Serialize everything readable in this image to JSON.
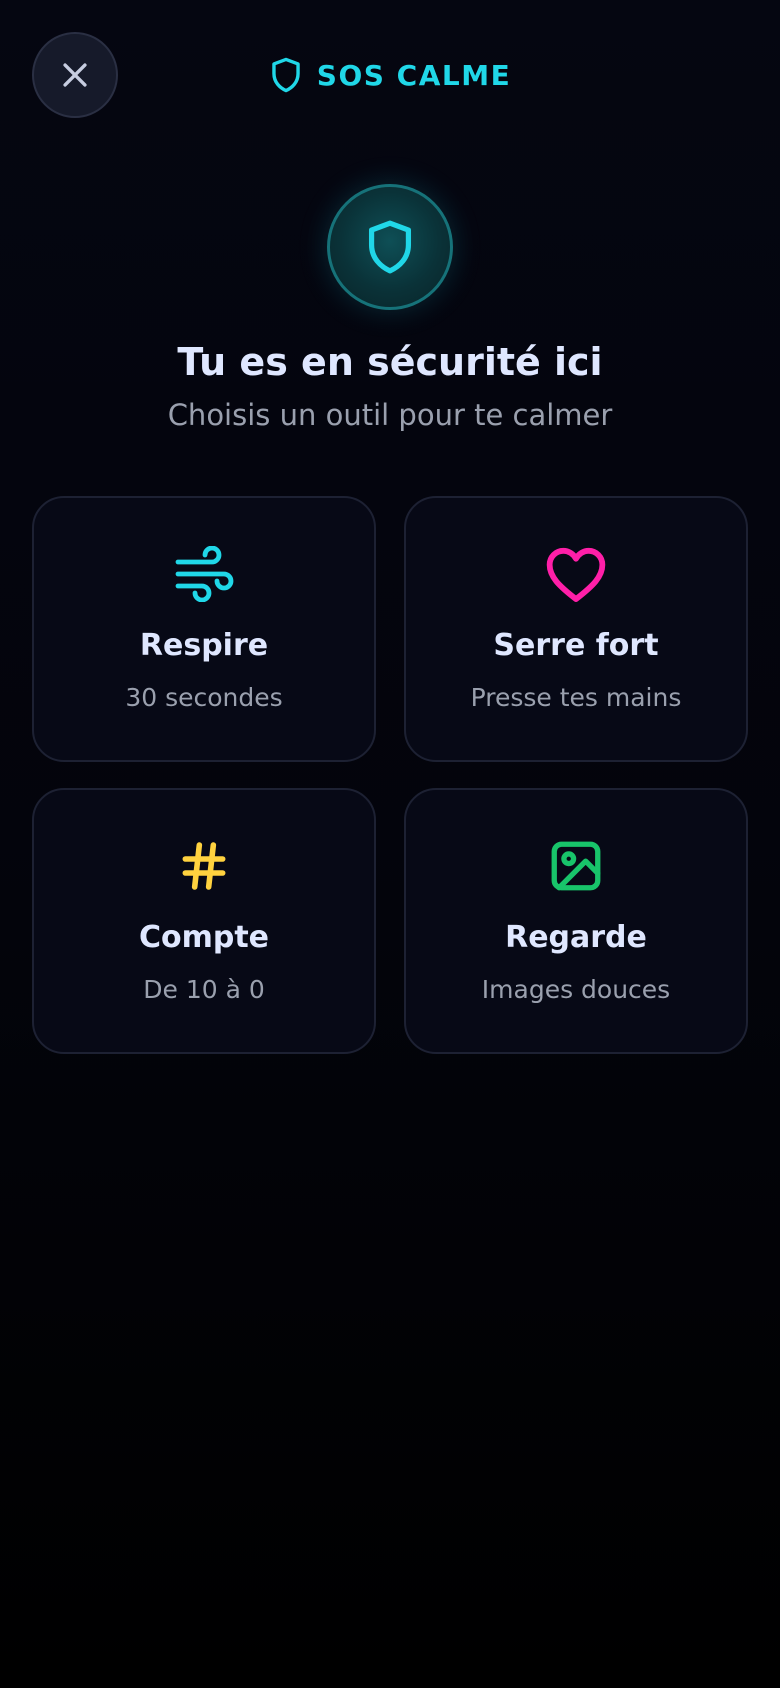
{
  "header": {
    "close_icon": "close-icon",
    "brand_icon": "shield-icon",
    "title": "SOS CALME"
  },
  "hero": {
    "icon": "shield-icon",
    "title": "Tu es en sécurité ici",
    "subtitle": "Choisis un outil pour te calmer"
  },
  "tools": [
    {
      "icon": "wind-icon",
      "title": "Respire",
      "subtitle": "30 secondes",
      "color": "#20d7e8"
    },
    {
      "icon": "heart-icon",
      "title": "Serre fort",
      "subtitle": "Presse tes mains",
      "color": "#ff1fa8"
    },
    {
      "icon": "hash-icon",
      "title": "Compte",
      "subtitle": "De 10 à 0",
      "color": "#ffd23f"
    },
    {
      "icon": "image-icon",
      "title": "Regarde",
      "subtitle": "Images douces",
      "color": "#18c46a"
    }
  ],
  "colors": {
    "accent": "#20d7e8",
    "background": "#050611",
    "card": "#070916",
    "text": "#dfe7ff",
    "muted": "#9aa0ae"
  }
}
